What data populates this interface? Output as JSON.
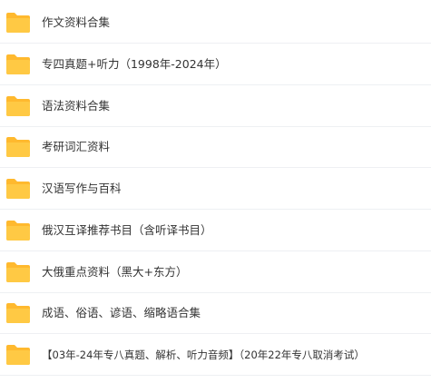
{
  "folder_color": "#FFC944",
  "folder_tab_color": "#FFB92E",
  "items": [
    {
      "label": "作文资料合集",
      "icon": "folder-icon"
    },
    {
      "label": "专四真题+听力（1998年-2024年）",
      "icon": "folder-icon"
    },
    {
      "label": "语法资料合集",
      "icon": "folder-icon"
    },
    {
      "label": "考研词汇资料",
      "icon": "folder-icon"
    },
    {
      "label": "汉语写作与百科",
      "icon": "folder-icon"
    },
    {
      "label": "俄汉互译推荐书目（含听译书目）",
      "icon": "folder-icon"
    },
    {
      "label": "大俄重点资料（黑大+东方）",
      "icon": "folder-icon"
    },
    {
      "label": "成语、俗语、谚语、缩略语合集",
      "icon": "folder-icon"
    },
    {
      "label": "【03年-24年专八真题、解析、听力音频】（20年22年专八取消考试）",
      "icon": "folder-icon"
    }
  ]
}
